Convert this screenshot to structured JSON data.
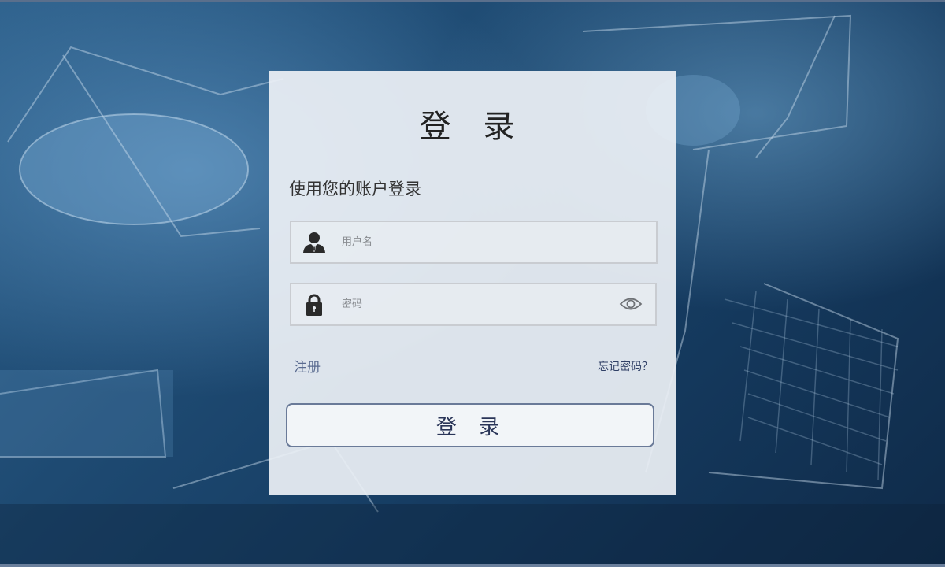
{
  "login": {
    "title": "登 录",
    "subtitle": "使用您的账户登录",
    "username": {
      "value": "",
      "placeholder": "用户名",
      "icon": "user-icon"
    },
    "password": {
      "value": "",
      "placeholder": "密码",
      "icon": "lock-icon",
      "toggle_icon": "eye-icon"
    },
    "register_label": "注册",
    "forgot_label": "忘记密码？",
    "submit_label": "登 录"
  },
  "colors": {
    "card_bg": "#eceff5",
    "field_border": "#c9ccd1",
    "button_border": "#6a7a98",
    "link_register": "#5a6b90",
    "link_forgot": "#2f3f66",
    "background": "#1e4a72"
  }
}
